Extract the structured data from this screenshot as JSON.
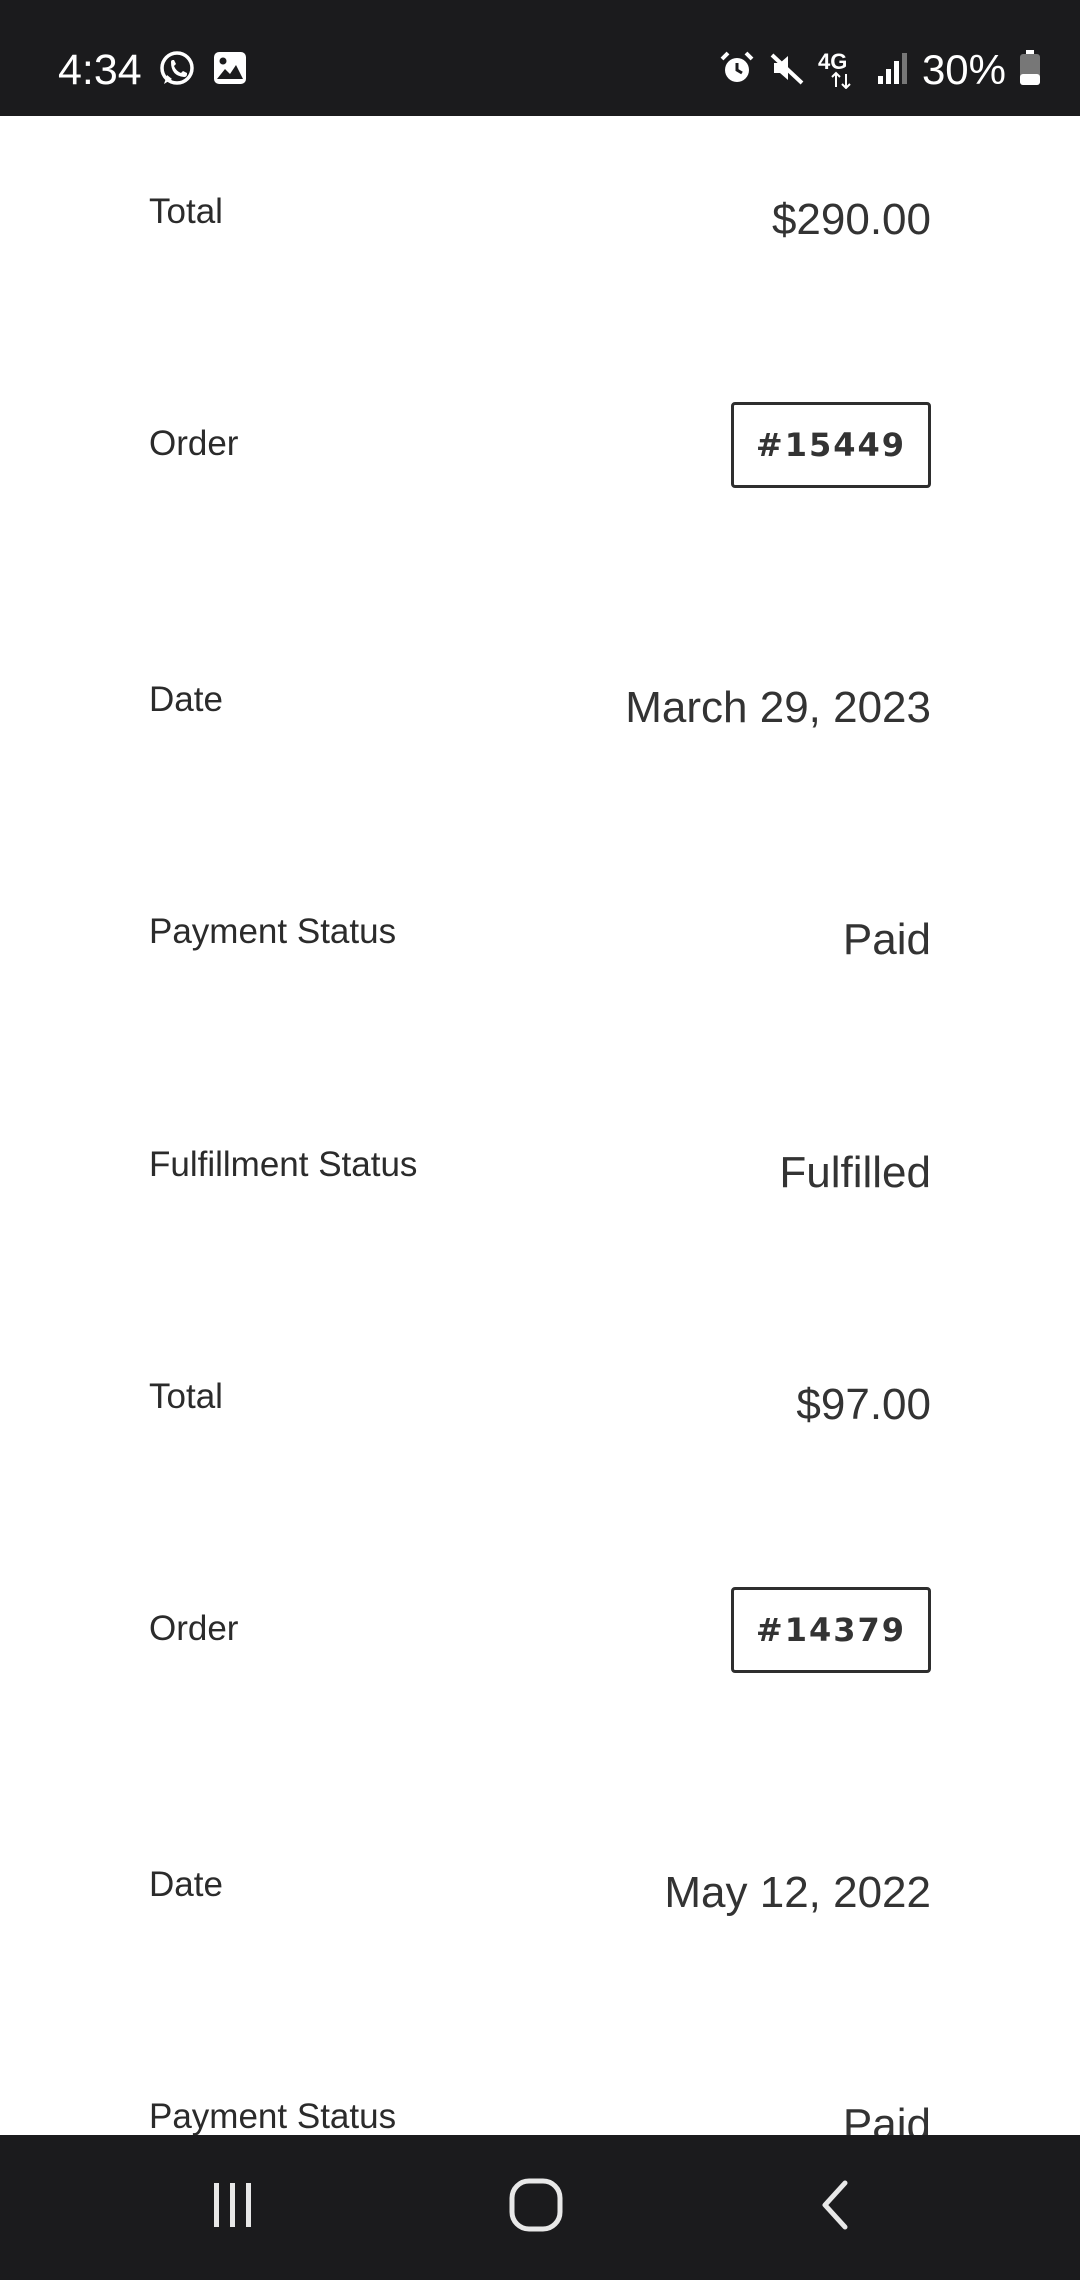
{
  "status_bar": {
    "time": "4:34",
    "battery": "30%",
    "network": "4G",
    "left_icons": [
      "whatsapp-icon",
      "gallery-icon"
    ],
    "right_icons": [
      "alarm-icon",
      "mute-icon",
      "network-4g-icon",
      "signal-icon",
      "battery-icon"
    ]
  },
  "orders": [
    {
      "total_label": "Total",
      "total": "$290.00"
    },
    {
      "order_label": "Order",
      "order_number": "#15449",
      "date_label": "Date",
      "date": "March 29, 2023",
      "payment_label": "Payment Status",
      "payment_status": "Paid",
      "fulfillment_label": "Fulfillment Status",
      "fulfillment_status": "Fulfilled",
      "total_label": "Total",
      "total": "$97.00"
    },
    {
      "order_label": "Order",
      "order_number": "#14379",
      "date_label": "Date",
      "date": "May 12, 2022",
      "payment_label": "Payment Status",
      "payment_status": "Paid"
    }
  ],
  "nav_bar": {
    "icons": [
      "recent-apps-icon",
      "home-icon",
      "back-icon"
    ]
  },
  "colors": {
    "bar_background": "#1b1b1d",
    "text": "#333333",
    "page_background": "#ffffff"
  }
}
